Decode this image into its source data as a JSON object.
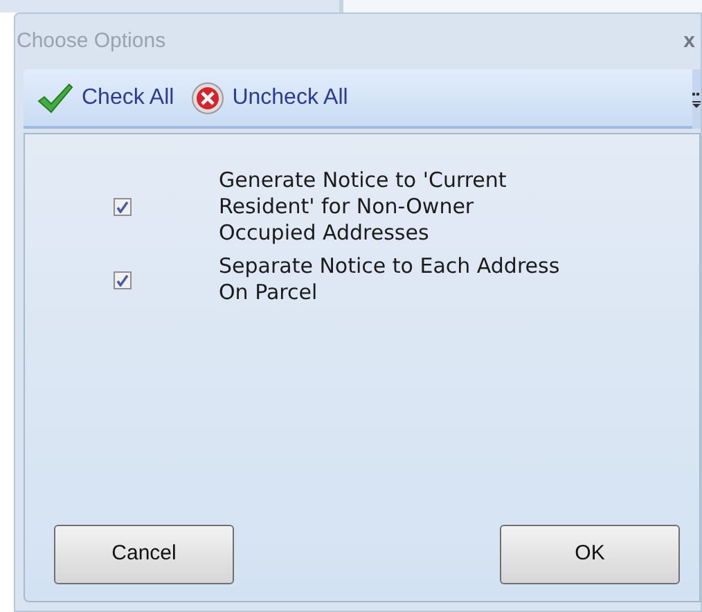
{
  "window": {
    "title": "Choose Options",
    "close": "x"
  },
  "toolbar": {
    "items": [
      {
        "kind": "check",
        "label": "Check All"
      },
      {
        "kind": "uncheck",
        "label": "Uncheck All"
      }
    ]
  },
  "options": [
    {
      "label": "Generate Notice to 'Current Resident' for Non-Owner Occupied Addresses",
      "checked": true
    },
    {
      "label": "Separate Notice to Each Address On Parcel",
      "checked": true
    }
  ],
  "buttons": [
    "Cancel",
    "OK"
  ]
}
